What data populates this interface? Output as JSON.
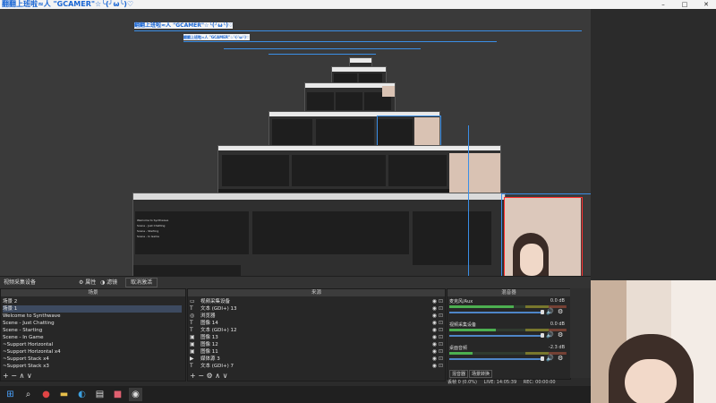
{
  "window": {
    "title": "翻翻上班啦≈人 \"GCAMER\"☆╰(╯ω╰)♡",
    "controls": [
      "–",
      "□",
      "✕"
    ]
  },
  "toolbar": {
    "capture_label": "视频采集设备",
    "properties_label": "属性",
    "filters_label": "滤镜",
    "deactivate_label": "取消激活"
  },
  "scenes": {
    "header": "场景",
    "items": [
      "场景 2",
      "场景 1",
      "Welcome to Synthwave",
      "Scene - Just Chatting",
      "Scene - Starting",
      "Scene - In Game",
      "~Support Horizontal",
      "~Support Horizontal x4",
      "~Support Stack x4",
      "~Support Stack x3"
    ],
    "selected_index": 1,
    "footer": "+ − ∧ ∨"
  },
  "sources": {
    "header": "来源",
    "items": [
      {
        "icon": "camera-icon",
        "glyph": "▭",
        "name": "视频采集设备"
      },
      {
        "icon": "text-icon",
        "glyph": "T",
        "name": "文本 (GDI+) 13"
      },
      {
        "icon": "browser-icon",
        "glyph": "◎",
        "name": "浏览器"
      },
      {
        "icon": "text-icon",
        "glyph": "T",
        "name": "图像 14"
      },
      {
        "icon": "text-icon",
        "glyph": "T",
        "name": "文本 (GDI+) 12"
      },
      {
        "icon": "image-icon",
        "glyph": "▣",
        "name": "图像 13"
      },
      {
        "icon": "image-icon",
        "glyph": "▣",
        "name": "图像 12"
      },
      {
        "icon": "image-icon",
        "glyph": "▣",
        "name": "图像 11"
      },
      {
        "icon": "media-icon",
        "glyph": "▶",
        "name": "媒体源 3"
      },
      {
        "icon": "text-icon",
        "glyph": "T",
        "name": "文本 (GDI+) 7"
      }
    ],
    "footer": "+ − ⚙ ∧ ∨"
  },
  "mixer": {
    "header": "混音器",
    "channels": [
      {
        "name": "麦克风/Aux",
        "db": "0.0 dB",
        "level": 0.55
      },
      {
        "name": "视频采集设备",
        "db": "0.0 dB",
        "level": 0.4
      },
      {
        "name": "桌面音频",
        "db": "-2.3 dB",
        "level": 0.2
      }
    ],
    "tab_mixer": "混音器",
    "tab_transitions": "场景转换"
  },
  "status": {
    "text": "丢帧 0 (0.0%)",
    "live": "LIVE: 14:05:39",
    "rec": "REC: 00:00:00"
  },
  "taskbar": {
    "icons": [
      "windows-start-icon",
      "search-icon",
      "browser-red-icon",
      "folder-icon",
      "edge-icon",
      "store-icon",
      "app-red-icon",
      "obs-icon"
    ]
  },
  "preview": {
    "nested_header": "翻翻上班啦≈人 \"GCAMER\"☆╰(╯ω╰)♡"
  }
}
